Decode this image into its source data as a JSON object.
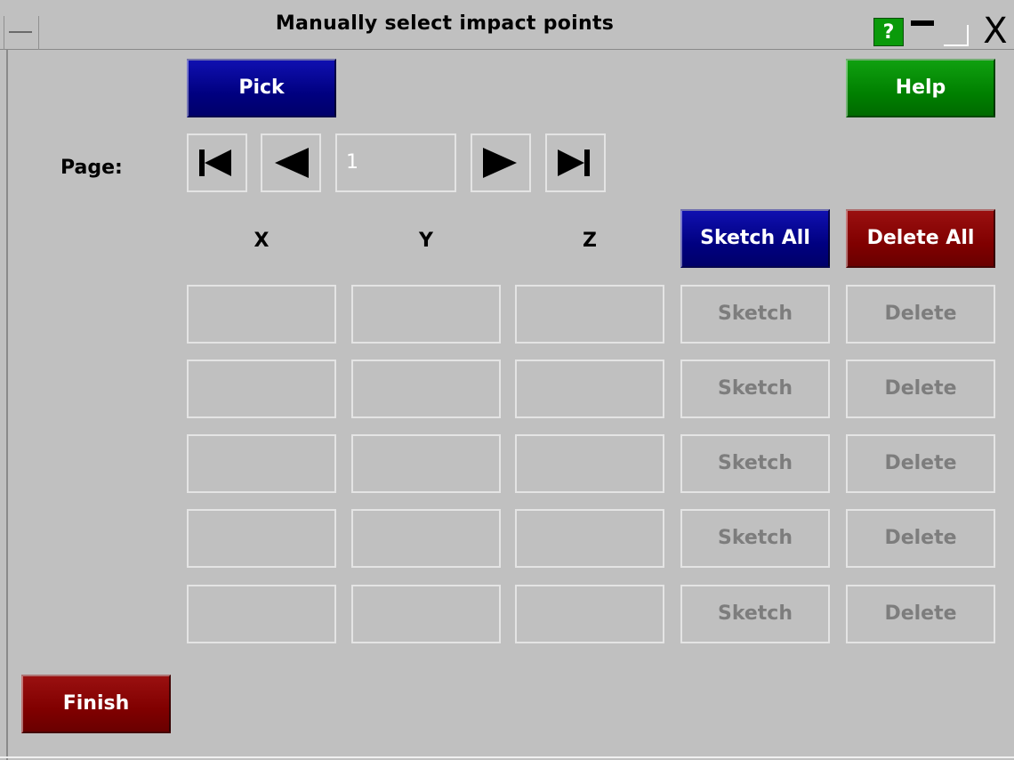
{
  "window": {
    "title": "Manually select impact points",
    "help_glyph": "?",
    "close_glyph": "X",
    "icons": [
      "menu-icon",
      "help-icon",
      "minimize-icon",
      "maximize-icon",
      "close-icon"
    ]
  },
  "toolbar": {
    "pick_label": "Pick",
    "help_label": "Help"
  },
  "pagination": {
    "label": "Page:",
    "current_page": "1"
  },
  "columns": {
    "x": "X",
    "y": "Y",
    "z": "Z",
    "sketch_all": "Sketch All",
    "delete_all": "Delete All"
  },
  "rows": [
    {
      "x": "",
      "y": "",
      "z": "",
      "sketch": "Sketch",
      "delete": "Delete"
    },
    {
      "x": "",
      "y": "",
      "z": "",
      "sketch": "Sketch",
      "delete": "Delete"
    },
    {
      "x": "",
      "y": "",
      "z": "",
      "sketch": "Sketch",
      "delete": "Delete"
    },
    {
      "x": "",
      "y": "",
      "z": "",
      "sketch": "Sketch",
      "delete": "Delete"
    },
    {
      "x": "",
      "y": "",
      "z": "",
      "sketch": "Sketch",
      "delete": "Delete"
    }
  ],
  "footer": {
    "finish_label": "Finish"
  },
  "colors": {
    "background": "#c0c0c0",
    "blue_button": "#000080",
    "green_button": "#008000",
    "red_button": "#800000",
    "disabled_text": "#7d7d7d"
  }
}
